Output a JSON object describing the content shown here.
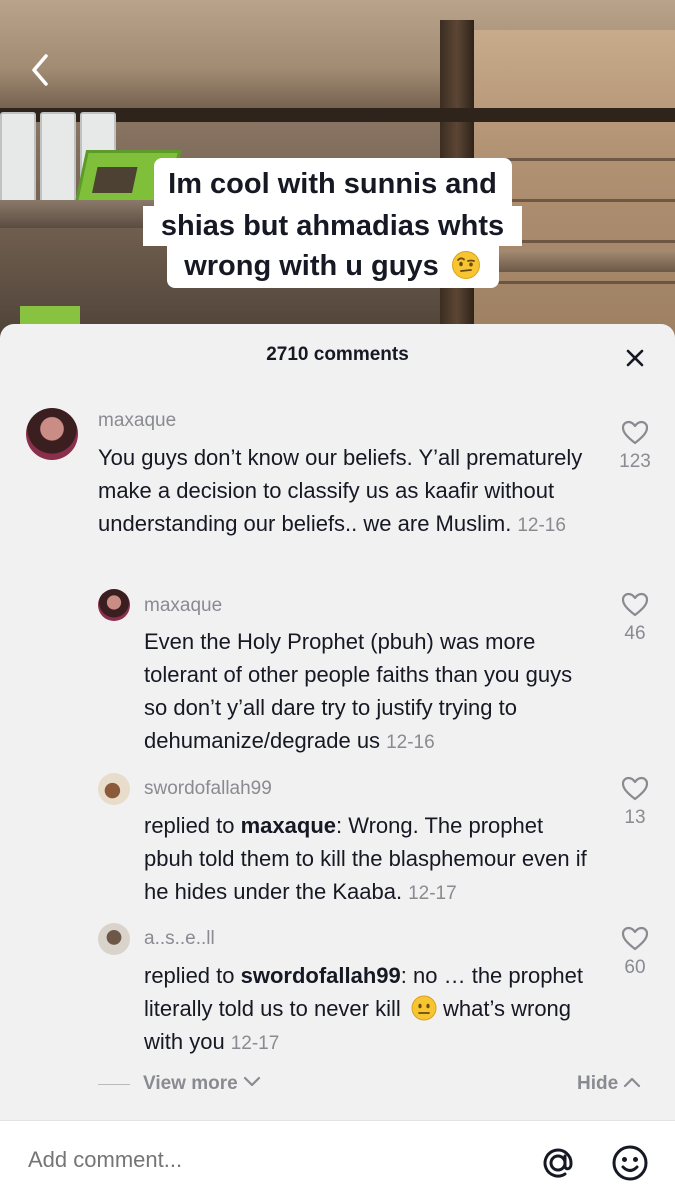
{
  "video": {
    "caption_lines": [
      "Im cool with sunnis and",
      "shias but ahmadias whts",
      "wrong with u guys"
    ],
    "caption_emoji": "raised-eyebrow-emoji"
  },
  "sheet": {
    "title": "2710 comments"
  },
  "comments": [
    {
      "username": "maxaque",
      "text": "You guys don’t know our beliefs. Y’all prematurely make a decision to classify us as kaafir without understanding our beliefs.. we are Muslim.",
      "date": "12-16",
      "likes": "123"
    },
    {
      "username": "maxaque",
      "text": "Even the Holy Prophet (pbuh) was more tolerant of other people faiths than you guys so don’t y’all dare try to justify trying to dehumanize/degrade us",
      "date": "12-16",
      "likes": "46"
    },
    {
      "username": "swordofallah99",
      "reply_prefix": "replied to ",
      "reply_to": "maxaque",
      "text": ": Wrong. The prophet pbuh told them to kill the blasphemour even if he hides under the Kaaba.",
      "date": "12-17",
      "likes": "13"
    },
    {
      "username": "a..s..e..ll",
      "reply_prefix": "replied to ",
      "reply_to": "swordofallah99",
      "text": ": no … the prophet literally told us to never kill",
      "emoji": "neutral-face-emoji",
      "text_after": "what’s wrong with you",
      "date": "12-17",
      "likes": "60"
    }
  ],
  "replies_controls": {
    "view_more": "View more",
    "hide": "Hide"
  },
  "input": {
    "placeholder": "Add comment..."
  },
  "icons": {
    "back": "chevron-left-icon",
    "close": "close-icon",
    "like": "heart-outline-icon",
    "mention": "at-sign-icon",
    "emoji": "smiley-icon"
  }
}
